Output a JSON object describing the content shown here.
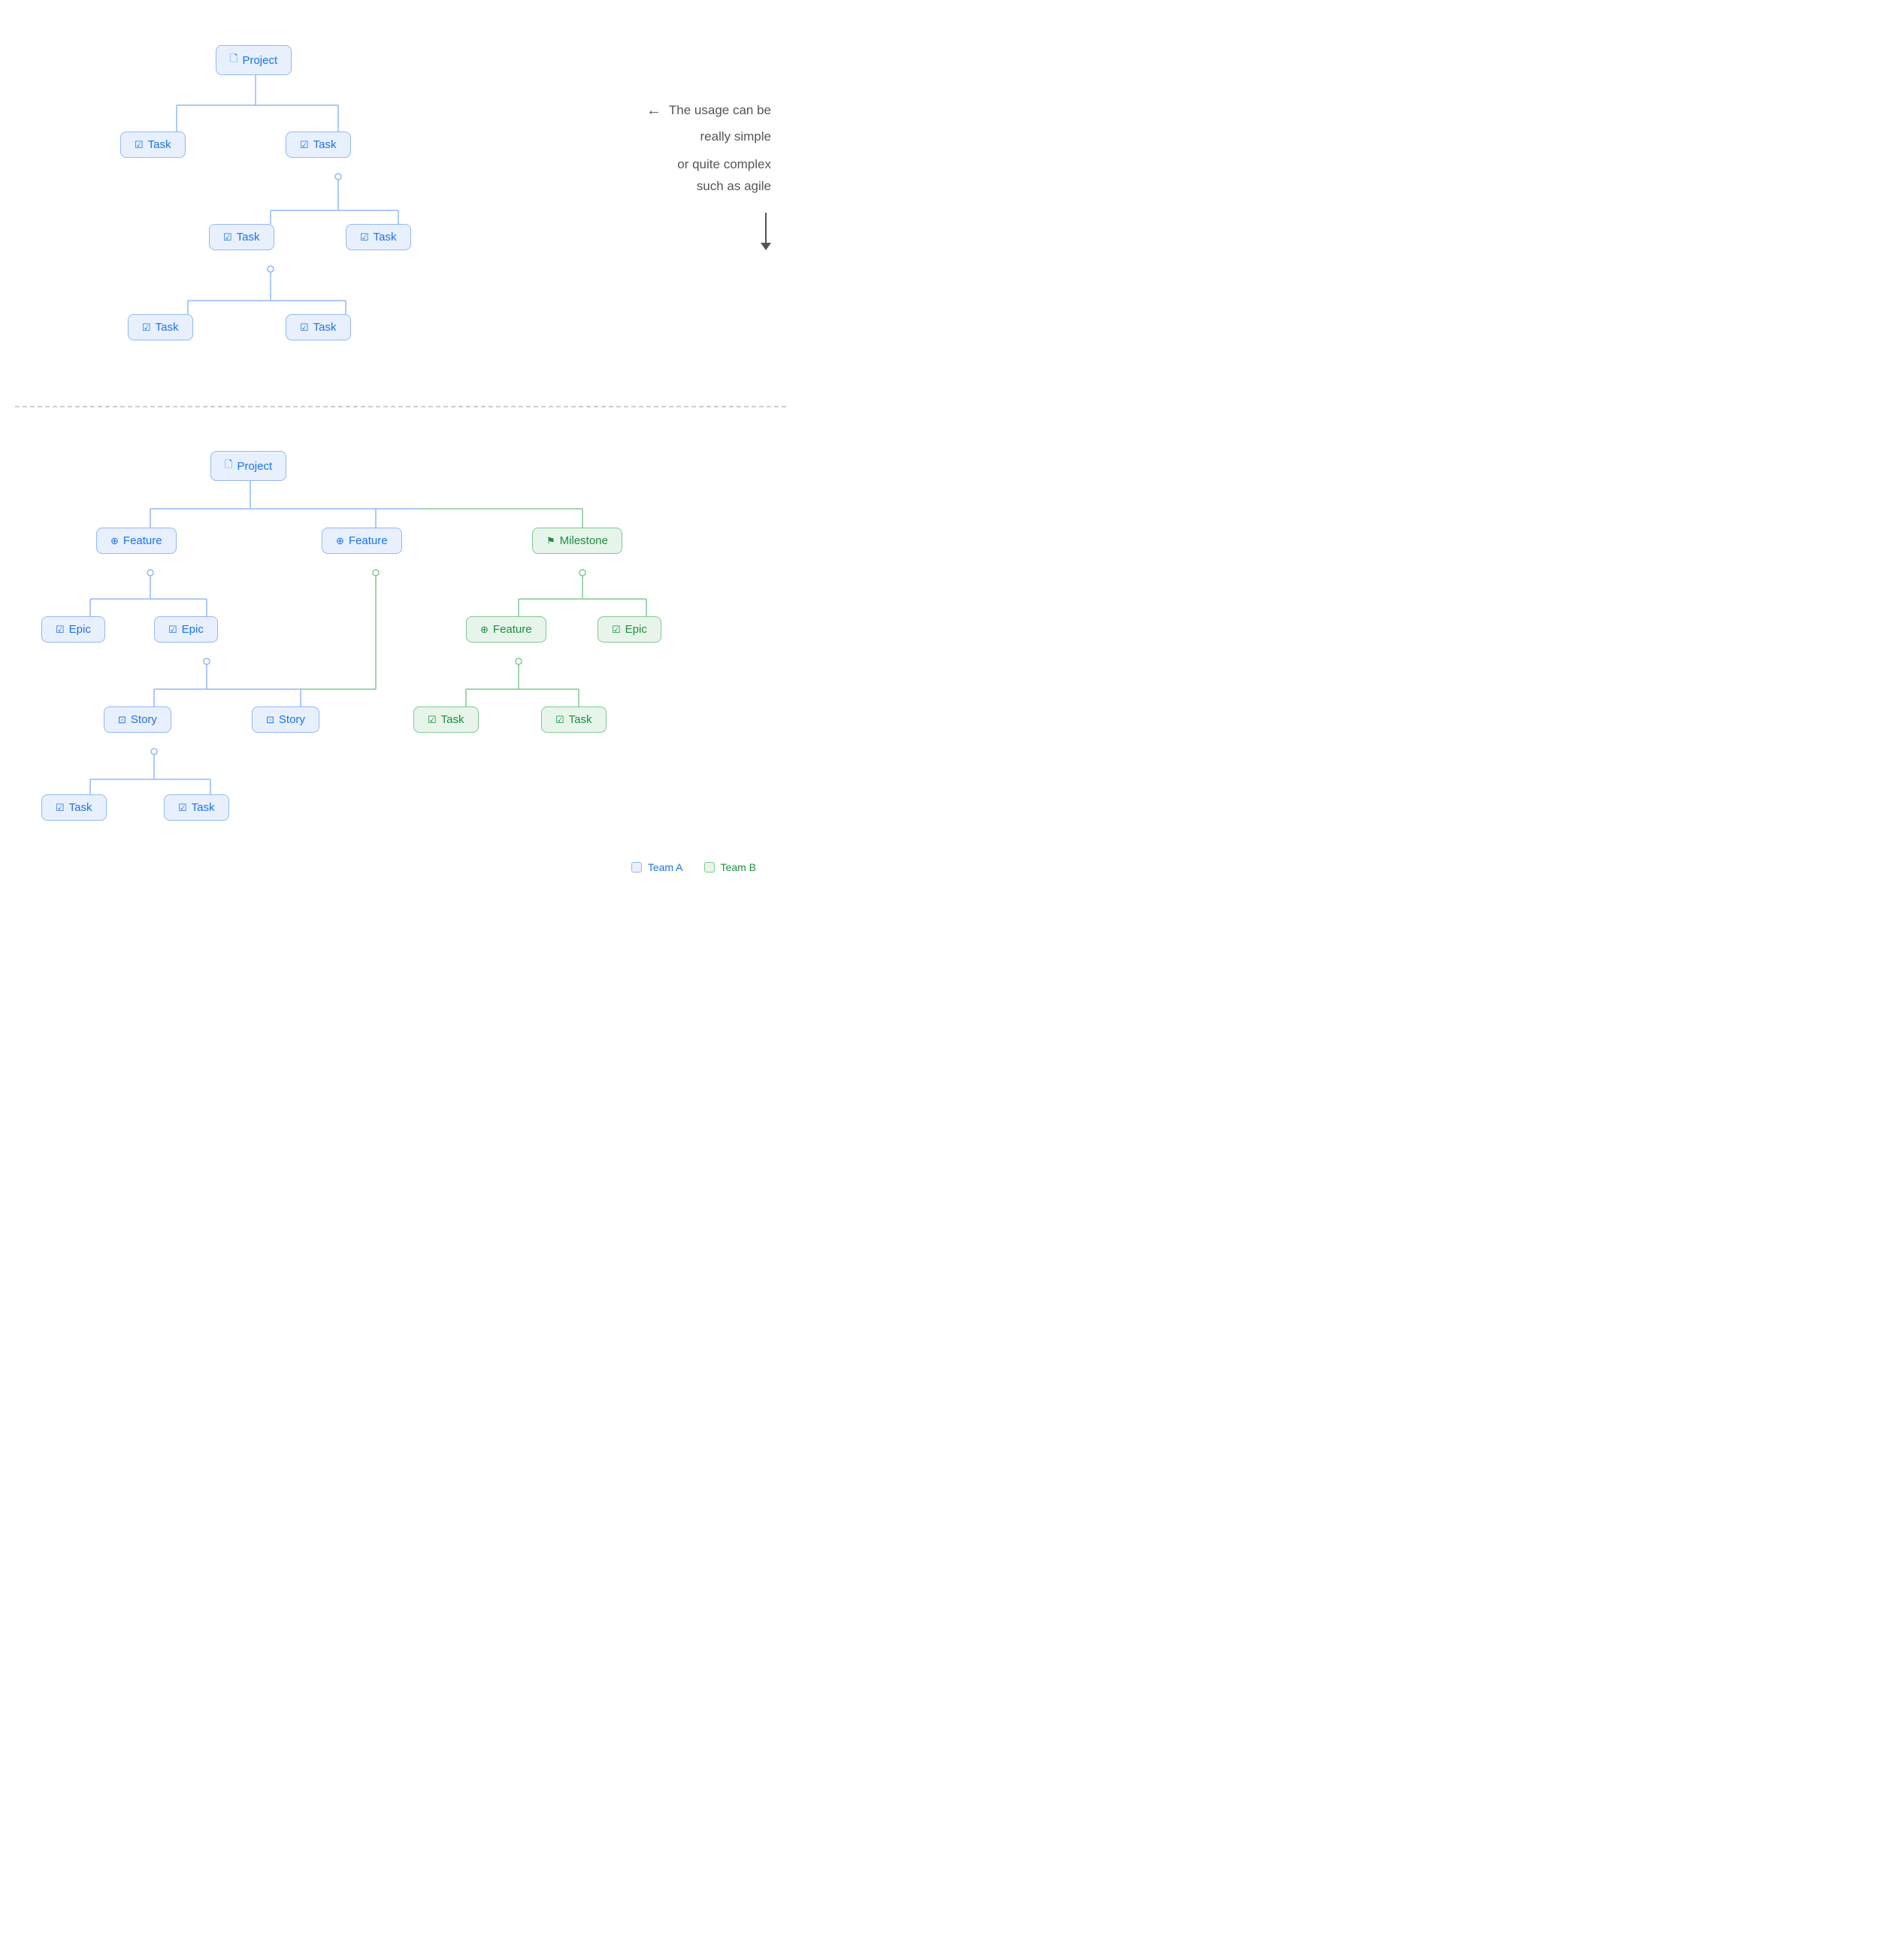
{
  "annotation": {
    "line1": "The usage can be",
    "line2": "really simple",
    "line3": "or quite complex",
    "line4": "such as agile"
  },
  "top_tree": {
    "nodes": [
      {
        "id": "t_project",
        "label": "Project",
        "type": "project",
        "color": "blue"
      },
      {
        "id": "t_task1",
        "label": "Task",
        "type": "task",
        "color": "blue"
      },
      {
        "id": "t_task2",
        "label": "Task",
        "type": "task",
        "color": "blue"
      },
      {
        "id": "t_task3",
        "label": "Task",
        "type": "task",
        "color": "blue"
      },
      {
        "id": "t_task4",
        "label": "Task",
        "type": "task",
        "color": "blue"
      },
      {
        "id": "t_task5",
        "label": "Task",
        "type": "task",
        "color": "blue"
      },
      {
        "id": "t_task6",
        "label": "Task",
        "type": "task",
        "color": "blue"
      }
    ]
  },
  "bottom_tree": {
    "project": {
      "label": "Project",
      "type": "project"
    },
    "features": [
      {
        "label": "Feature",
        "type": "feature"
      },
      {
        "label": "Feature",
        "type": "feature"
      }
    ],
    "milestone": {
      "label": "Milestone",
      "type": "milestone"
    },
    "epics": [
      {
        "label": "Epic",
        "type": "epic"
      },
      {
        "label": "Epic",
        "type": "epic"
      }
    ],
    "feature_sub": {
      "label": "Feature",
      "type": "feature"
    },
    "epic_sub": {
      "label": "Epic",
      "type": "epic"
    },
    "stories": [
      {
        "label": "Story",
        "type": "story"
      },
      {
        "label": "Story",
        "type": "story"
      }
    ],
    "tasks_blue": [
      {
        "label": "Task",
        "type": "task"
      },
      {
        "label": "Task",
        "type": "task"
      }
    ],
    "tasks_green": [
      {
        "label": "Task",
        "type": "task"
      },
      {
        "label": "Task",
        "type": "task"
      }
    ]
  },
  "legend": {
    "team_a": "Team A",
    "team_b": "Team B"
  },
  "icons": {
    "project": "🗋",
    "task": "☑",
    "feature": "⊕",
    "epic": "☑",
    "story": "⊡",
    "milestone": "⚑"
  }
}
